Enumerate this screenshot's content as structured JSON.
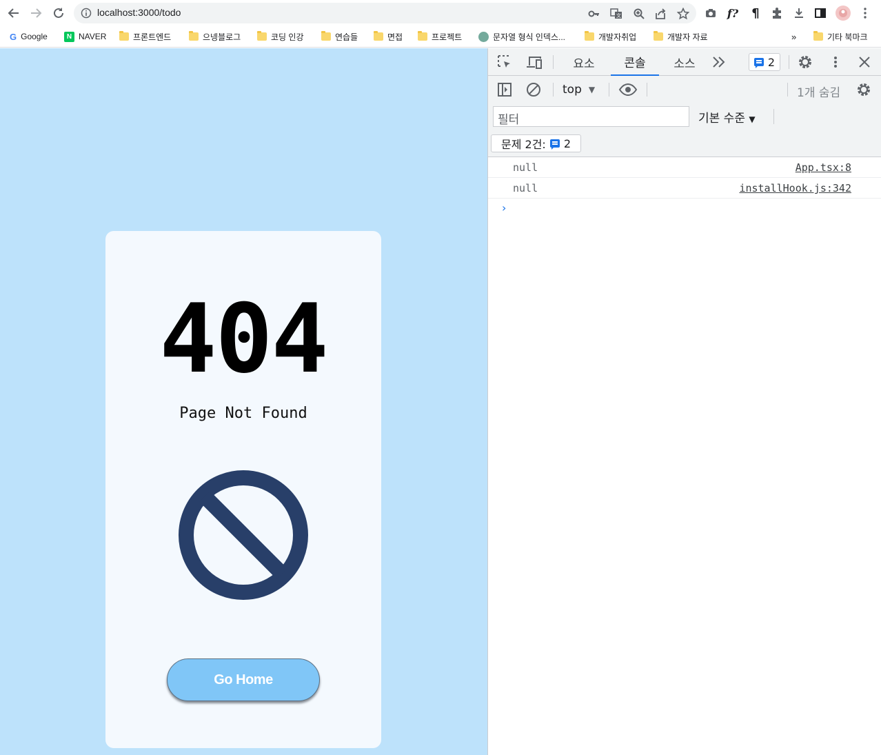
{
  "browser": {
    "url": "localhost:3000/todo",
    "bookmarks": [
      {
        "label": "Google",
        "icon": "google-icon"
      },
      {
        "label": "NAVER",
        "icon": "naver-icon"
      },
      {
        "label": "프론트엔드",
        "icon": "folder-icon"
      },
      {
        "label": "으넹블로그",
        "icon": "folder-icon"
      },
      {
        "label": "코딩 인강",
        "icon": "folder-icon"
      },
      {
        "label": "연습들",
        "icon": "folder-icon"
      },
      {
        "label": "면접",
        "icon": "folder-icon"
      },
      {
        "label": "프로젝트",
        "icon": "folder-icon"
      },
      {
        "label": "문자열 형식 인덱스...",
        "icon": "openai-icon"
      },
      {
        "label": "개발자취업",
        "icon": "folder-icon"
      },
      {
        "label": "개발자 자료",
        "icon": "folder-icon"
      }
    ],
    "overflow_label": "»",
    "other_bookmarks": "기타 북마크"
  },
  "page": {
    "code": "404",
    "message": "Page Not Found",
    "button_label": "Go Home",
    "colors": {
      "background": "#bde2fb",
      "card": "#f4f9fe",
      "icon": "#283f69",
      "button": "#80c6f7"
    }
  },
  "devtools": {
    "tabs": [
      "요소",
      "콘솔",
      "소스"
    ],
    "active_tab": "콘솔",
    "issues_count": "2",
    "context": "top",
    "hidden_count": "1개 숨김",
    "filter_placeholder": "필터",
    "levels_label": "기본 수준",
    "issues_label": "문제 2건:",
    "issues_badge": "2",
    "logs": [
      {
        "message": "null",
        "source": "App.tsx:8"
      },
      {
        "message": "null",
        "source": "installHook.js:342"
      }
    ],
    "prompt": "›"
  }
}
